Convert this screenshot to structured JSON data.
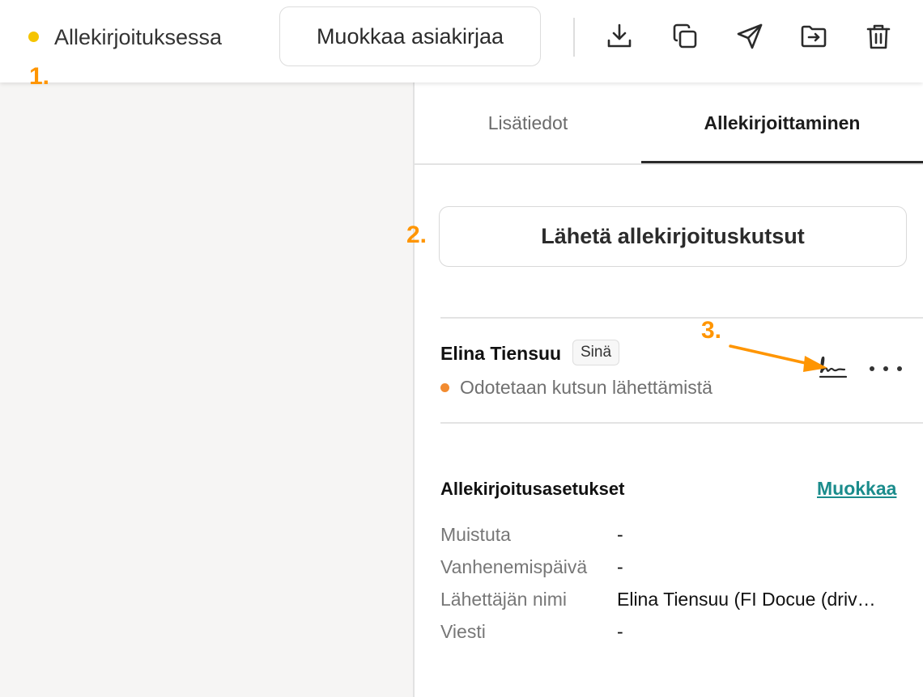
{
  "topbar": {
    "status_label": "Allekirjoituksessa",
    "status_color": "#f5c400",
    "edit_document_label": "Muokkaa asiakirjaa",
    "icons": [
      "download-icon",
      "copy-icon",
      "send-icon",
      "move-to-folder-icon",
      "trash-icon"
    ]
  },
  "markers": {
    "one": "1.",
    "two": "2.",
    "three": "3."
  },
  "tabs": [
    {
      "label": "Lisätiedot",
      "active": false
    },
    {
      "label": "Allekirjoittaminen",
      "active": true
    }
  ],
  "send_invitations_label": "Lähetä allekirjoituskutsut",
  "signer": {
    "name": "Elina Tiensuu",
    "badge": "Sinä",
    "status": "Odotetaan kutsun lähettämistä",
    "status_color": "#f28b30"
  },
  "settings": {
    "title": "Allekirjoitusasetukset",
    "edit_label": "Muokkaa",
    "rows": [
      {
        "label": "Muistuta",
        "value": "-"
      },
      {
        "label": "Vanhenemispäivä",
        "value": "-"
      },
      {
        "label": "Lähettäjän nimi",
        "value": "Elina Tiensuu (FI Docue (driv…"
      },
      {
        "label": "Viesti",
        "value": "-"
      }
    ]
  },
  "accent_color": "#ff9500",
  "link_color": "#1b8c8c"
}
